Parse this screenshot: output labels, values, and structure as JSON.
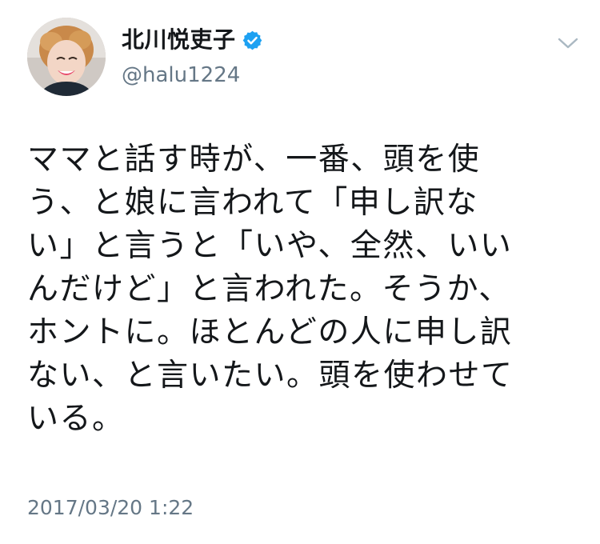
{
  "author": {
    "display_name": "北川悦吏子",
    "handle": "@halu1224",
    "verified": true,
    "avatar_icon": "avatar-photo",
    "verified_color": "#1da1f2"
  },
  "tweet": {
    "lines": [
      "ママと話す時が、一番、頭を使",
      "う、と娘に言われて「申し訳な",
      "い」と言うと「いや、全然、いい",
      "んだけど」と言われた。そうか、",
      "ホントに。ほとんどの人に申し訳",
      "ない、と言いたい。頭を使わせて",
      "いる。"
    ],
    "timestamp": "2017/03/20 1:22"
  },
  "menu": {
    "icon": "chevron-down-icon"
  },
  "colors": {
    "text": "#14171a",
    "secondary": "#657786"
  }
}
